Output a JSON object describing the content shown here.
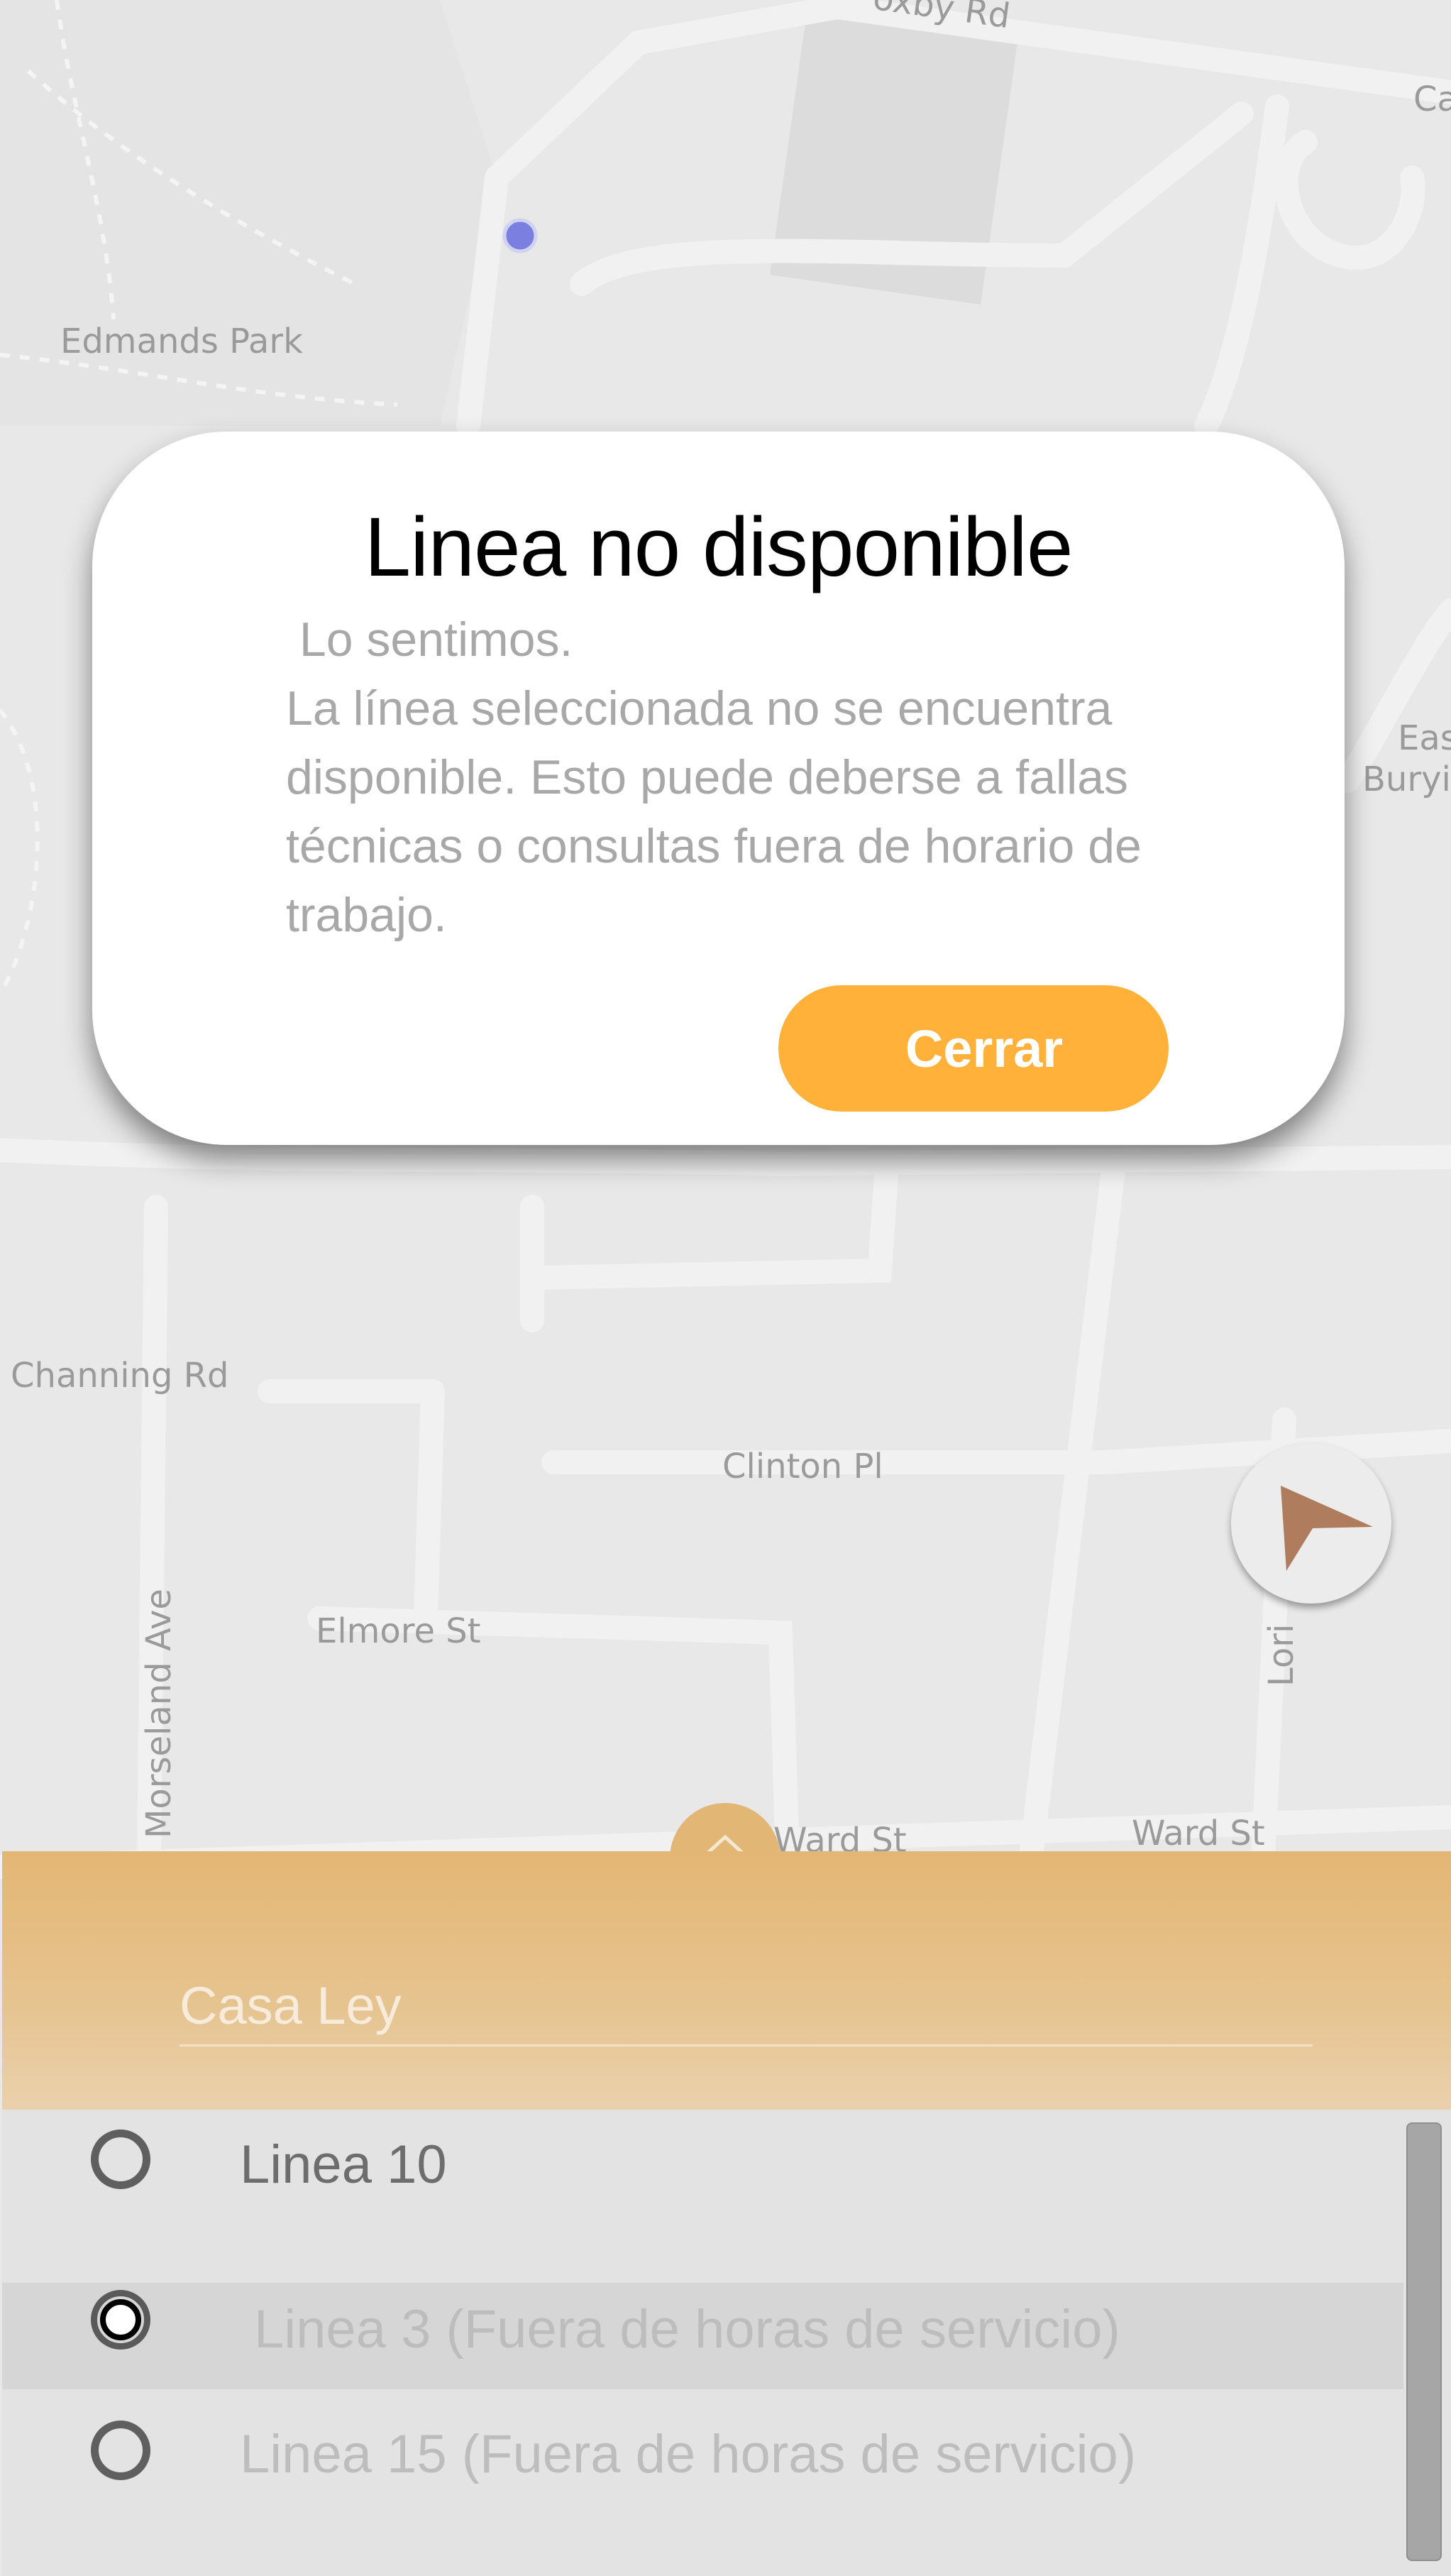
{
  "map": {
    "labels": [
      "oxby Rd",
      "Ca",
      "Edmands Park",
      "Eas",
      "Buryi",
      "Channing Rd",
      "Clinton Pl",
      "Elmore St",
      "Morseland Ave",
      "Lori",
      "Ward St",
      "Ward St"
    ]
  },
  "dialog": {
    "title": "Linea no disponible",
    "message_lines": [
      " Lo sentimos.",
      "La línea seleccionada no se encuentra",
      "disponible. Esto puede deberse a fallas",
      "técnicas o consultas fuera de horario de",
      "trabajo."
    ],
    "close_label": "Cerrar"
  },
  "sheet": {
    "store_label": "Casa Ley"
  },
  "lines": [
    {
      "label": "Linea 10",
      "selected": false
    },
    {
      "label": "Linea 3 (Fuera de horas de servicio)",
      "selected": true
    },
    {
      "label": "Linea 15 (Fuera de horas de servicio)",
      "selected": false
    }
  ],
  "colors": {
    "accent": "#ffb139",
    "sheet": "#e4b674",
    "location_dot": "#7b7fe0",
    "compass_arrow": "#b07c5e"
  }
}
